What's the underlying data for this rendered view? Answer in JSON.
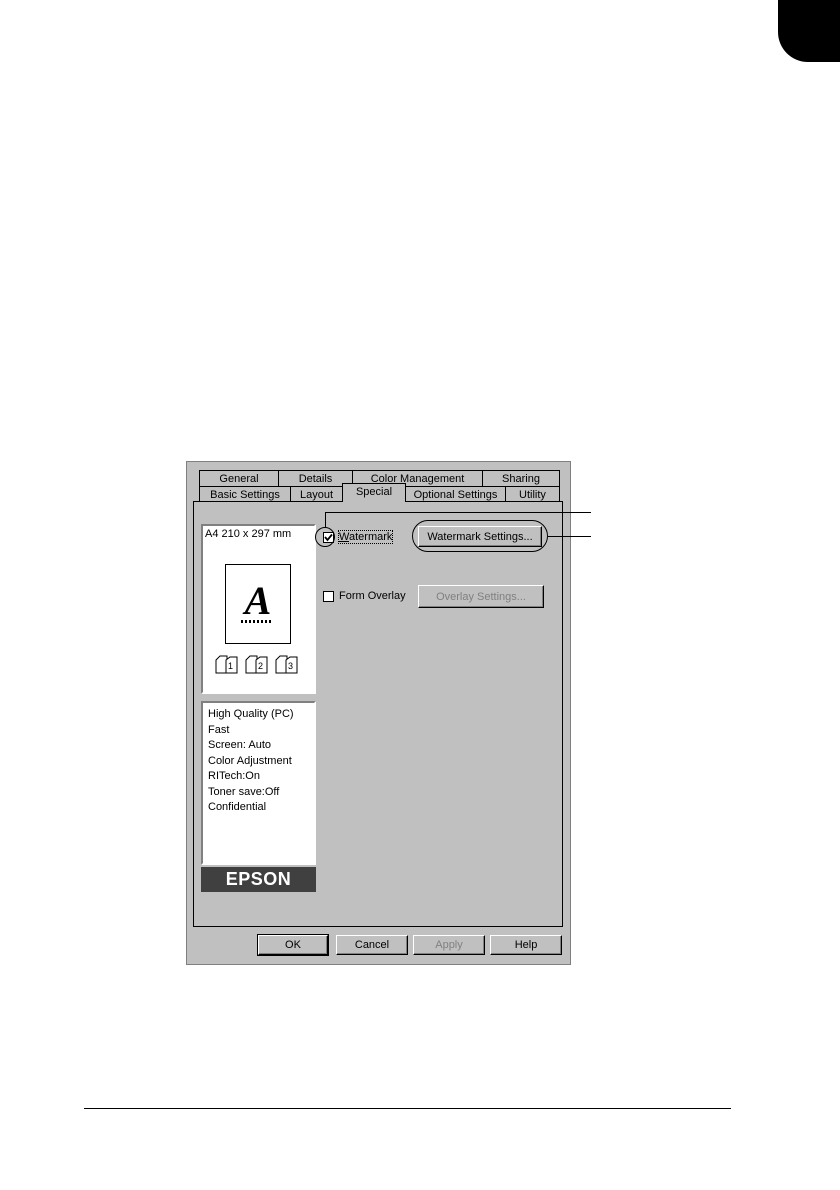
{
  "tabs_row1": [
    "General",
    "Details",
    "Color Management",
    "Sharing"
  ],
  "tabs_row2": [
    "Basic Settings",
    "Layout",
    "Special",
    "Optional Settings",
    "Utility"
  ],
  "active_tab": "Special",
  "preview": {
    "paper_size": "A4 210 x 297 mm",
    "letter": "A",
    "copies": [
      "1",
      "2",
      "3"
    ]
  },
  "settings_summary": [
    "High Quality (PC)",
    "Fast",
    "Screen: Auto",
    "Color Adjustment",
    "RITech:On",
    "Toner save:Off",
    "Confidential"
  ],
  "brand": "EPSON",
  "watermark": {
    "label": "Watermark",
    "checked": true,
    "button": "Watermark Settings..."
  },
  "form_overlay": {
    "label": "Form Overlay",
    "checked": false,
    "button": "Overlay Settings..."
  },
  "footer_buttons": {
    "ok": "OK",
    "cancel": "Cancel",
    "apply": "Apply",
    "help": "Help"
  },
  "icons": {
    "checkmark": "check-icon",
    "copy": "page-copy-icon"
  }
}
